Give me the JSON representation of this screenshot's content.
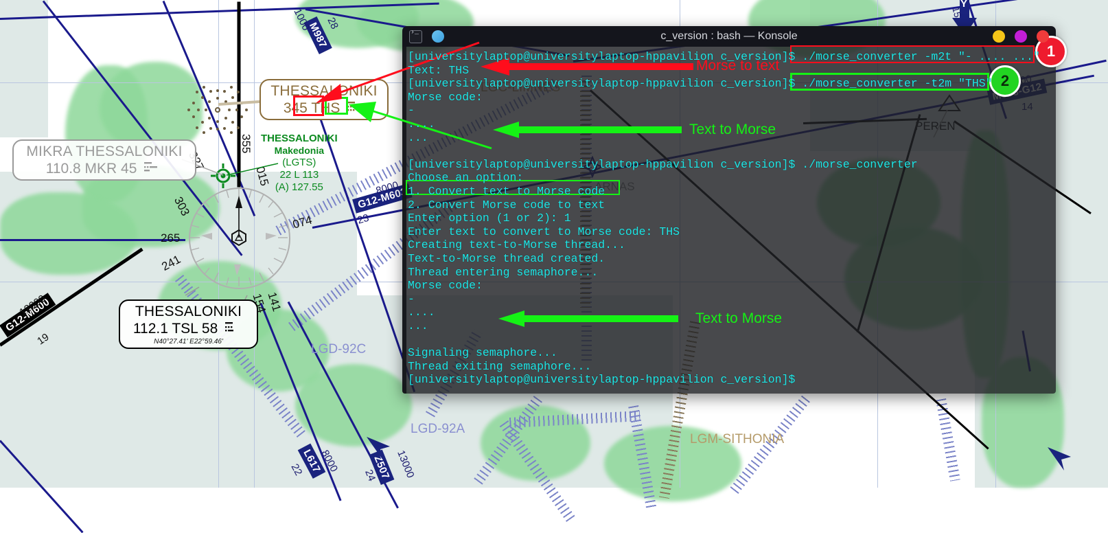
{
  "window": {
    "title": "c_version : bash — Konsole",
    "icons": [
      "terminal-icon",
      "tab-icon"
    ],
    "buttons": [
      {
        "name": "minimize-button",
        "color": "#f5c518"
      },
      {
        "name": "maximize-button",
        "color": "#c21ed6"
      },
      {
        "name": "close-button",
        "color": "#ef3b3b"
      }
    ]
  },
  "terminal": {
    "prompt": "[universitylaptop@universitylaptop-hppavilion c_version]$",
    "lines": [
      {
        "id": "l01",
        "text": "[universitylaptop@universitylaptop-hppavilion c_version]$ ./morse_converter -m2t \"- .... ...\""
      },
      {
        "id": "l02",
        "text": "Text: THS"
      },
      {
        "id": "l03",
        "text": "[universitylaptop@universitylaptop-hppavilion c_version]$ ./morse_converter -t2m \"THS\""
      },
      {
        "id": "l04",
        "text": "Morse code:"
      },
      {
        "id": "l05",
        "text": "-"
      },
      {
        "id": "l06",
        "text": "...."
      },
      {
        "id": "l07",
        "text": "..."
      },
      {
        "id": "l08",
        "text": ""
      },
      {
        "id": "l09",
        "text": "[universitylaptop@universitylaptop-hppavilion c_version]$ ./morse_converter"
      },
      {
        "id": "l10",
        "text": "Choose an option:"
      },
      {
        "id": "l11",
        "text": "1. Convert text to Morse code"
      },
      {
        "id": "l12",
        "text": "2. Convert Morse code to text"
      },
      {
        "id": "l13",
        "text": "Enter option (1 or 2): 1"
      },
      {
        "id": "l14",
        "text": "Enter text to convert to Morse code: THS"
      },
      {
        "id": "l15",
        "text": "Creating text-to-Morse thread..."
      },
      {
        "id": "l16",
        "text": "Text-to-Morse thread created."
      },
      {
        "id": "l17",
        "text": "Thread entering semaphore..."
      },
      {
        "id": "l18",
        "text": "Morse code:"
      },
      {
        "id": "l19",
        "text": "-"
      },
      {
        "id": "l20",
        "text": "...."
      },
      {
        "id": "l21",
        "text": "..."
      },
      {
        "id": "l22",
        "text": ""
      },
      {
        "id": "l23",
        "text": "Signaling semaphore..."
      },
      {
        "id": "l24",
        "text": "Thread exiting semaphore..."
      },
      {
        "id": "l25",
        "text": "[universitylaptop@universitylaptop-hppavilion c_version]$"
      }
    ],
    "text_color": "#1ee8e8"
  },
  "annotations": {
    "morse_to_text_label": "Morse to text",
    "text_to_morse_label_top": "Text to Morse",
    "text_to_morse_label_bottom": "Text to Morse",
    "badge_1": "1",
    "badge_2": "2",
    "red": "#ff0d1c",
    "green": "#15f215",
    "badge_1_color": "#ee1b2e",
    "badge_2_color": "#22d422"
  },
  "map": {
    "navaids": [
      {
        "name": "THESSALONIKI",
        "freq_line": "345 THS",
        "style": "brown",
        "ident": "THS"
      },
      {
        "name": "MIKRA THESSALONIKI",
        "freq_line": "110.8 MKR 45",
        "style": "grey"
      },
      {
        "name": "THESSALONIKI",
        "freq_line": "112.1 TSL 58",
        "coords": "N40°27.41' E22°59.46'",
        "style": "black"
      }
    ],
    "airport_info": {
      "name": "THESSALONIKI",
      "region": "Makedonia",
      "icao": "(LGTS)",
      "runway": "22 L 113",
      "atis": "(A) 127.55"
    },
    "compass_bearings": [
      "355",
      "327",
      "303",
      "265",
      "241",
      "015",
      "074",
      "141",
      "154",
      "345"
    ],
    "airway_labels": [
      {
        "text": "M987",
        "alt": "1000",
        "dist": "28"
      },
      {
        "text": "G12-M603",
        "alt": "8000",
        "dist": "23"
      },
      {
        "text": "G12-M600",
        "alt": "12000",
        "dist": "19"
      },
      {
        "text": "M603-G12",
        "alt": "8000",
        "dist": "14"
      },
      {
        "text": "L617",
        "alt": "8000",
        "dist": "22"
      },
      {
        "text": "Z507",
        "alt": "13000",
        "dist": "24"
      }
    ],
    "zones": [
      {
        "text": "LGD-92C"
      },
      {
        "text": "LGD-92A"
      },
      {
        "text": "LGC-LIMNES",
        "style": "tan"
      },
      {
        "text": "LGM-SITHONIA",
        "style": "tan"
      }
    ],
    "waypoints": [
      {
        "text": "PEREN"
      },
      {
        "text": "ARNAS"
      }
    ]
  }
}
